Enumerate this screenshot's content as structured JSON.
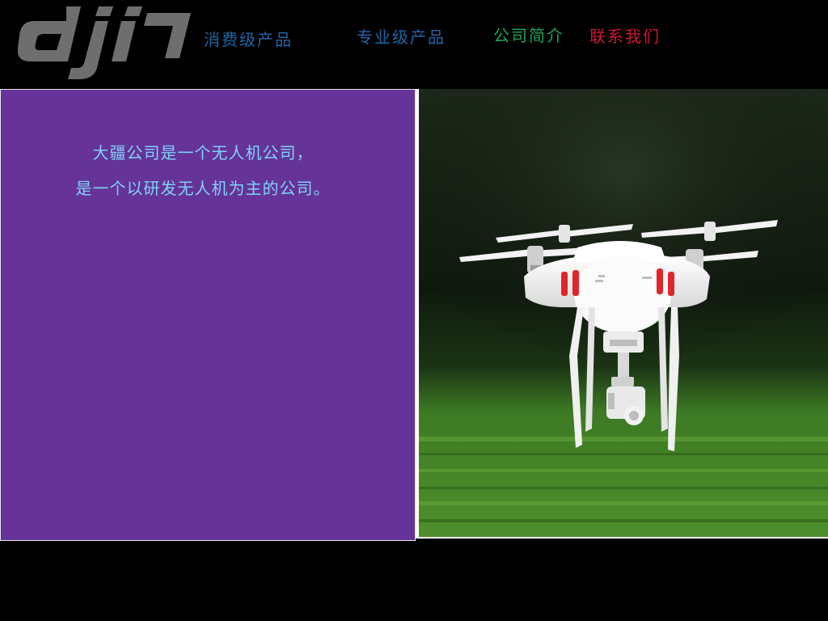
{
  "header": {
    "logo_icon": "dji-logo",
    "logo_color": "#6e6e6e",
    "nav": {
      "consumer_products": "消费级产品",
      "professional_products": "专业级产品",
      "company_intro": "公司简介",
      "contact_us": "联系我们"
    }
  },
  "main": {
    "intro_line_1": "大疆公司是一个无人机公司，",
    "intro_line_2": "是一个以研发无人机为主的公司。",
    "panel_color": "#663399",
    "photo_icon": "drone-photo"
  }
}
